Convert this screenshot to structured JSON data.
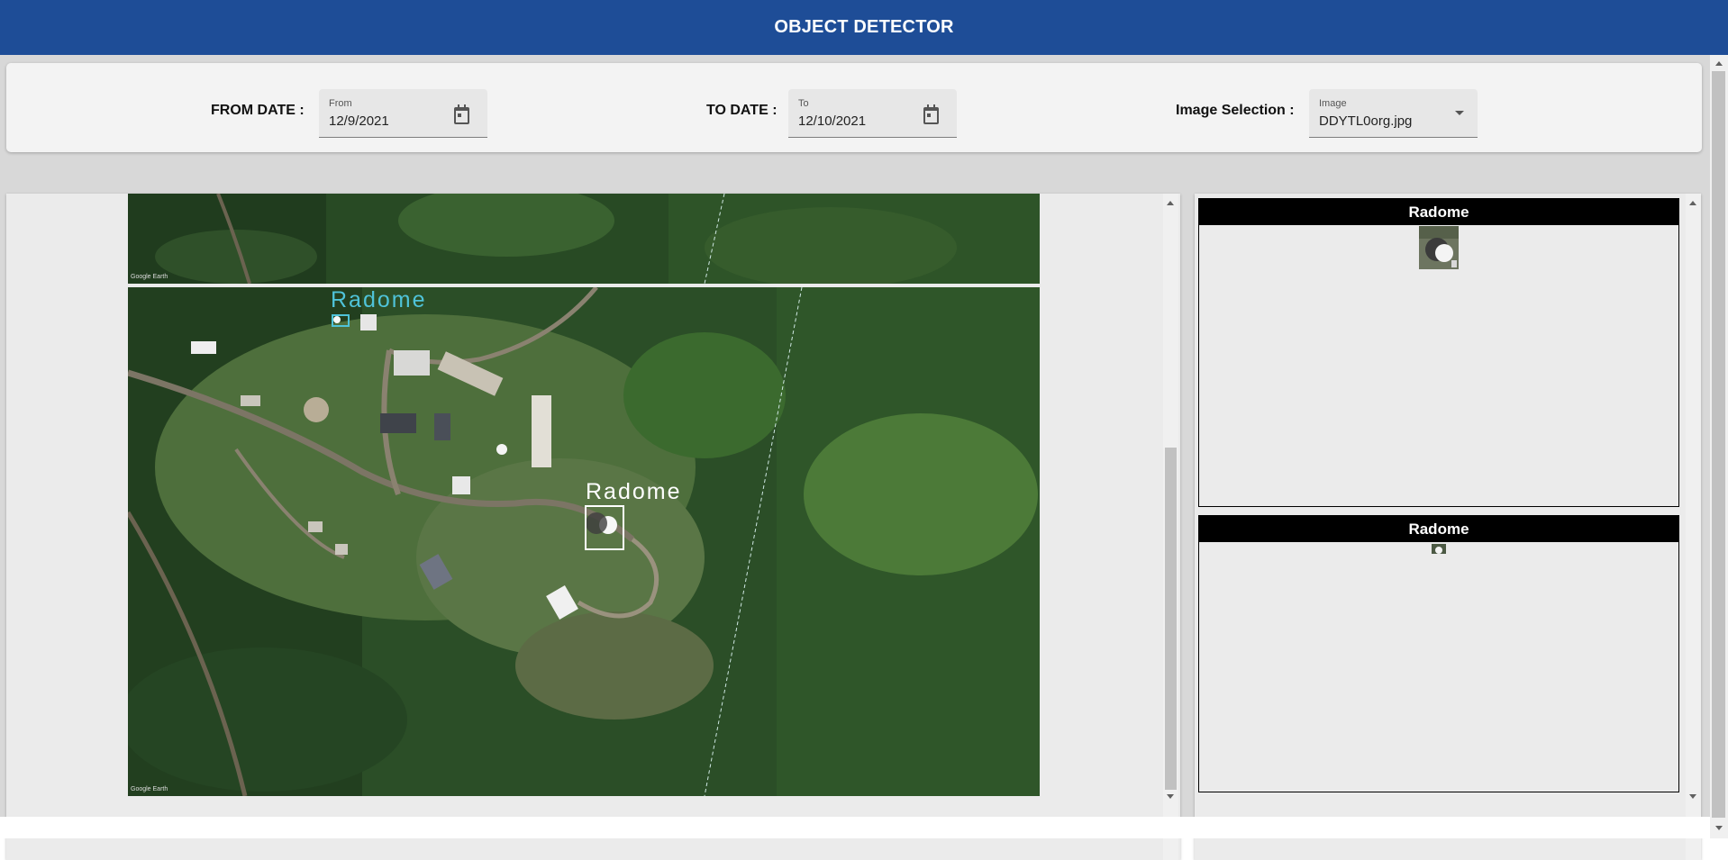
{
  "header": {
    "title": "OBJECT DETECTOR"
  },
  "filters": {
    "from_label": "FROM DATE :",
    "from_caption": "From",
    "from_value": "12/9/2021",
    "to_label": "TO DATE :",
    "to_caption": "To",
    "to_value": "12/10/2021",
    "image_label": "Image Selection :",
    "image_caption": "Image",
    "image_value": "DDYTL0org.jpg"
  },
  "viewer": {
    "detections": [
      {
        "label": "Radome"
      },
      {
        "label": "Radome"
      }
    ],
    "watermark": "Google Earth"
  },
  "results": {
    "items": [
      {
        "label": "Radome"
      },
      {
        "label": "Radome"
      }
    ]
  },
  "icons": {
    "from_icon": "calendar-icon",
    "to_icon": "calendar-icon",
    "image_icon": "dropdown-arrow-icon"
  },
  "colors": {
    "header_bg": "#1e4d97",
    "detection_highlight": "#4fc3d9",
    "detection_box": "#ffffff",
    "result_header_bg": "#000000"
  }
}
